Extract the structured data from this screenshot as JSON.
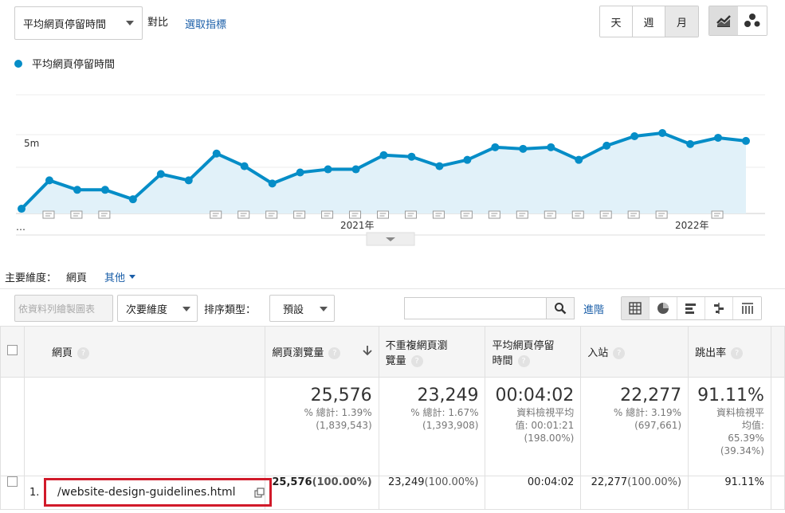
{
  "header": {
    "metric_select": "平均網頁停留時間",
    "compare_label": "對比",
    "choose_metric": "選取指標",
    "period_buttons": [
      "天",
      "週",
      "月"
    ],
    "active_period": "月",
    "chart_type_icons": [
      "line-chart-icon",
      "motion-chart-icon"
    ]
  },
  "legend": {
    "label": "平均網頁停留時間",
    "color": "#058dc7"
  },
  "chart_data": {
    "type": "area",
    "ytick": "5m",
    "xtick_labels": [
      "…",
      "2021年",
      "2022年"
    ],
    "series": [
      {
        "name": "平均網頁停留時間",
        "color": "#058dc7",
        "fill": "#e1f1f9",
        "values_minutes": [
          0.3,
          2.1,
          1.5,
          1.5,
          0.9,
          2.5,
          2.1,
          3.8,
          3.0,
          1.9,
          2.6,
          2.8,
          2.8,
          3.7,
          3.6,
          3.0,
          3.4,
          4.2,
          4.1,
          4.2,
          3.4,
          4.3,
          4.9,
          5.1,
          4.4,
          4.8,
          4.6
        ]
      }
    ]
  },
  "dimension_bar": {
    "label": "主要維度：",
    "active": "網頁",
    "other": "其他"
  },
  "toolbar": {
    "plot_rows": "依資料列繪製圖表",
    "secondary_dimension": "次要維度",
    "sort_type_label": "排序類型：",
    "sort_value": "預設",
    "search_placeholder": "",
    "advanced": "進階"
  },
  "table": {
    "columns": [
      "網頁",
      "網頁瀏覽量",
      "不重複網頁瀏覽量",
      "平均網頁停留時間",
      "入站",
      "跳出率"
    ],
    "column_lines": {
      "upv": [
        "不重複網頁瀏",
        "覽量"
      ],
      "avg": [
        "平均網頁停留",
        "時間"
      ]
    },
    "summary": {
      "pageviews": {
        "value": "25,576",
        "lines": [
          "% 總計: 1.39%",
          "(1,839,543)"
        ]
      },
      "unique_pageviews": {
        "value": "23,249",
        "lines": [
          "% 總計: 1.67%",
          "(1,393,908)"
        ]
      },
      "avg_time": {
        "value": "00:04:02",
        "lines": [
          "資料檢視平均",
          "值: 00:01:21",
          "(198.00%)"
        ]
      },
      "entrances": {
        "value": "22,277",
        "lines": [
          "% 總計: 3.19%",
          "(697,661)"
        ]
      },
      "bounce_rate": {
        "value": "91.11%",
        "lines": [
          "資料檢視平",
          "均值:",
          "65.39%",
          "(39.34%)"
        ]
      }
    },
    "rows": [
      {
        "index": "1.",
        "page": "/website-design-guidelines.html",
        "pageviews": "25,576",
        "pageviews_pct": "(100.00%)",
        "unique_pageviews": "23,249",
        "unique_pageviews_pct": "(100.00%)",
        "avg_time": "00:04:02",
        "entrances": "22,277",
        "entrances_pct": "(100.00%)",
        "bounce_rate": "91.11%"
      }
    ]
  }
}
